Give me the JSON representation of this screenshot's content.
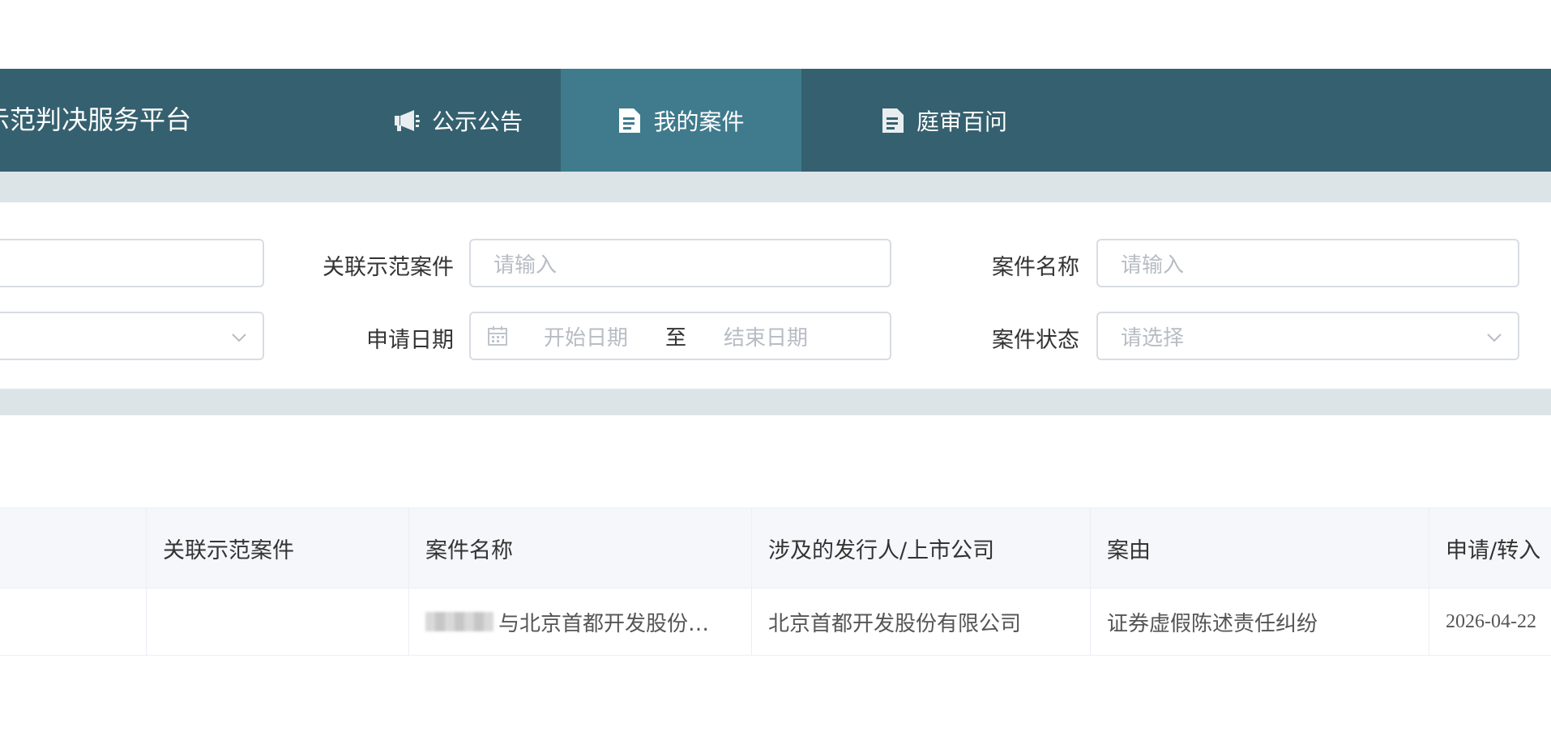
{
  "header": {
    "brand": "示范判决服务平台",
    "nav": [
      {
        "label": "公示公告",
        "icon": "megaphone-icon",
        "active": false
      },
      {
        "label": "我的案件",
        "icon": "document-icon",
        "active": true
      },
      {
        "label": "庭审百问",
        "icon": "document-icon",
        "active": false
      }
    ]
  },
  "filters": {
    "related_case_label": "关联示范案件",
    "related_case_placeholder": "请输入",
    "case_name_label": "案件名称",
    "case_name_placeholder": "请输入",
    "apply_date_label": "申请日期",
    "start_date_placeholder": "开始日期",
    "range_separator": "至",
    "end_date_placeholder": "结束日期",
    "case_status_label": "案件状态",
    "case_status_placeholder": "请选择"
  },
  "table": {
    "columns": [
      "",
      "关联示范案件",
      "案件名称",
      "涉及的发行人/上市公司",
      "案由",
      "申请/转入"
    ],
    "rows": [
      [
        "",
        "",
        "与北京首都开发股份…",
        "北京首都开发股份有限公司",
        "证券虚假陈述责任纠纷",
        "2026-04-22"
      ]
    ]
  },
  "colors": {
    "header_bg": "#35606f",
    "active_tab_bg": "#3f7b8c",
    "band_bg": "#dde4e7"
  }
}
